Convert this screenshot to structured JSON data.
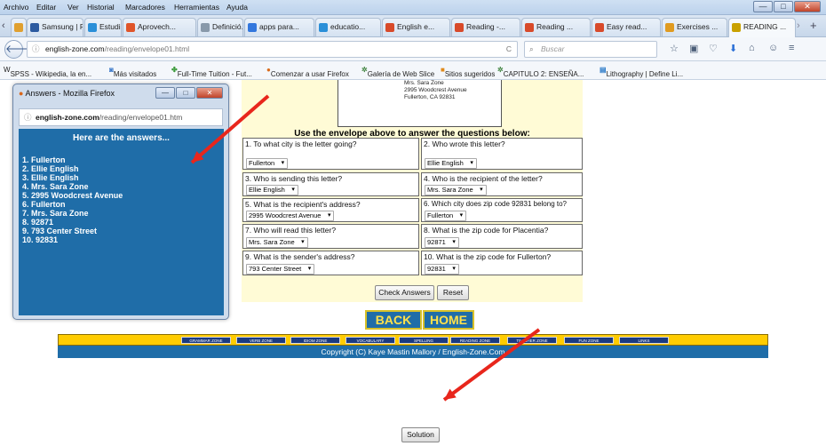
{
  "menubar": {
    "items": [
      "Archivo",
      "Editar",
      "Ver",
      "Historial",
      "Marcadores",
      "Herramientas",
      "Ayuda"
    ]
  },
  "window_controls": {
    "minimize": "—",
    "maximize": "□",
    "close": "✕"
  },
  "tabs": [
    {
      "label": "sung ...",
      "icon": "tab-icon",
      "color": "#e0a030"
    },
    {
      "label": "Samsung | Pa...",
      "icon": "tab-icon",
      "color": "#2c5aa0"
    },
    {
      "label": "Estudia in...",
      "icon": "tab-icon",
      "color": "#2a8fd8"
    },
    {
      "label": "Aprovech...",
      "icon": "tab-icon",
      "color": "#e0552a"
    },
    {
      "label": "Definició...",
      "icon": "tab-icon",
      "color": "#8899aa"
    },
    {
      "label": "apps para...",
      "icon": "tab-icon",
      "color": "#3377dd"
    },
    {
      "label": "educatio...",
      "icon": "tab-icon",
      "color": "#2a8fd8"
    },
    {
      "label": "English e...",
      "icon": "tab-icon",
      "color": "#d84a2a"
    },
    {
      "label": "Reading -...",
      "icon": "tab-icon",
      "color": "#d84a2a"
    },
    {
      "label": "Reading ...",
      "icon": "tab-icon",
      "color": "#d84a2a"
    },
    {
      "label": "Easy read...",
      "icon": "tab-icon",
      "color": "#d84a2a"
    },
    {
      "label": "Exercises ...",
      "icon": "tab-icon",
      "color": "#e09b20"
    },
    {
      "label": "READING ...",
      "icon": "tab-icon",
      "color": "#c9a100"
    }
  ],
  "navbar": {
    "url_domain": "english-zone.com",
    "url_path": "/reading/envelope01.html",
    "search_placeholder": "Buscar"
  },
  "bookmarks": [
    "SPSS - Wikipedia, la en...",
    "Más visitados",
    "Full-Time Tuition - Fut...",
    "Comenzar a usar Firefox",
    "Galería de Web Slice",
    "Sitios sugeridos",
    "CAPITULO 2: ENSEÑA...",
    "Lithography | Define Li..."
  ],
  "envelope": {
    "lines": [
      "Mrs. Sara Zone",
      "2995 Woodcrest Avenue",
      "Fullerton, CA 92831"
    ]
  },
  "instructions": "Use the envelope above to answer the questions below:",
  "questions": [
    {
      "q": "1. To what city is the letter going?",
      "a": "Fullerton"
    },
    {
      "q": "2. Who wrote this letter?",
      "a": "Ellie English"
    },
    {
      "q": "3. Who is sending this letter?",
      "a": "Ellie English"
    },
    {
      "q": "4. Who is the recipient of the letter?",
      "a": "Mrs. Sara Zone"
    },
    {
      "q": "5. What is the recipient's address?",
      "a": "2995 Woodcrest Avenue"
    },
    {
      "q": "6. Which city does zip code 92831 belong to?",
      "a": "Fullerton"
    },
    {
      "q": "7. Who will read this letter?",
      "a": "Mrs. Sara Zone"
    },
    {
      "q": "8. What is the zip code for Placentia?",
      "a": "92871"
    },
    {
      "q": "9. What is the sender's address?",
      "a": "793 Center Street"
    },
    {
      "q": "10. What is the zip code for Fullerton?",
      "a": "92831"
    }
  ],
  "buttons": {
    "check": "Check Answers",
    "reset": "Reset",
    "back": "BACK",
    "home": "HOME",
    "solution": "Solution"
  },
  "zones": [
    "GRAMMAR ZONE",
    "VERB ZONE",
    "IDIOM ZONE",
    "VOCABULARY",
    "SPELLING",
    "READING ZONE",
    "TEACHER ZONE",
    "FUN ZONE",
    "LINKS"
  ],
  "copyright": "Copyright (C) Kaye Mastin Mallory / English-Zone.Com",
  "popup": {
    "title": "Answers - Mozilla Firefox",
    "url_domain": "english-zone.com",
    "url_path": "/reading/envelope01.htm",
    "heading": "Here are the answers...",
    "answers": [
      "1. Fullerton",
      "2. Ellie English",
      "3. Ellie English",
      "4. Mrs. Sara Zone",
      "5. 2995 Woodcrest Avenue",
      "6. Fullerton",
      "7. Mrs. Sara Zone",
      "8. 92871",
      "9. 793 Center Street",
      "10. 92831"
    ]
  },
  "annotation_color": "#e8261c"
}
